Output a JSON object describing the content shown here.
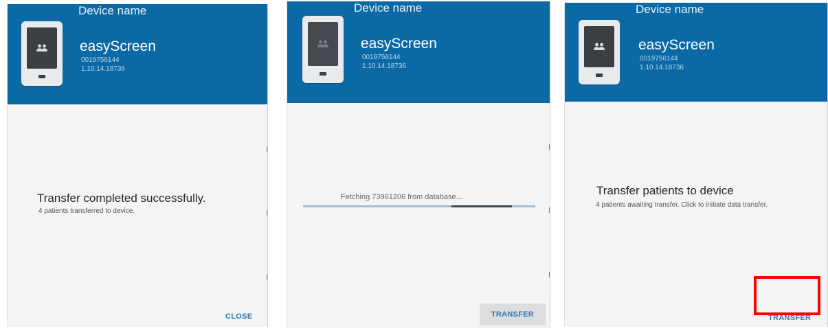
{
  "device_label": "Device name",
  "device": {
    "app_name": "easyScreen",
    "serial": "0019756144",
    "version": "1.10.14.18736"
  },
  "panel_success": {
    "title": "Transfer completed successfully.",
    "subtitle": "4 patients transferred to device.",
    "close_label": "CLOSE"
  },
  "panel_progress": {
    "message": "Fetching 73961206 from database...",
    "progress_segment_start": 0.64,
    "progress_segment_end": 0.9,
    "transfer_label": "TRANSFER",
    "transfer_state": "disabled"
  },
  "panel_ready": {
    "title": "Transfer patients to device",
    "subtitle": "4 patients awaiting transfer. Click to initiate data transfer.",
    "transfer_label": "TRANSFER"
  },
  "colors": {
    "header_blue": "#0b6aa6",
    "accent_text": "#2a78b5",
    "highlight": "#ff0000"
  },
  "icons": {
    "device_icon": "tablet-icon",
    "patients_icon": "people-icon"
  }
}
